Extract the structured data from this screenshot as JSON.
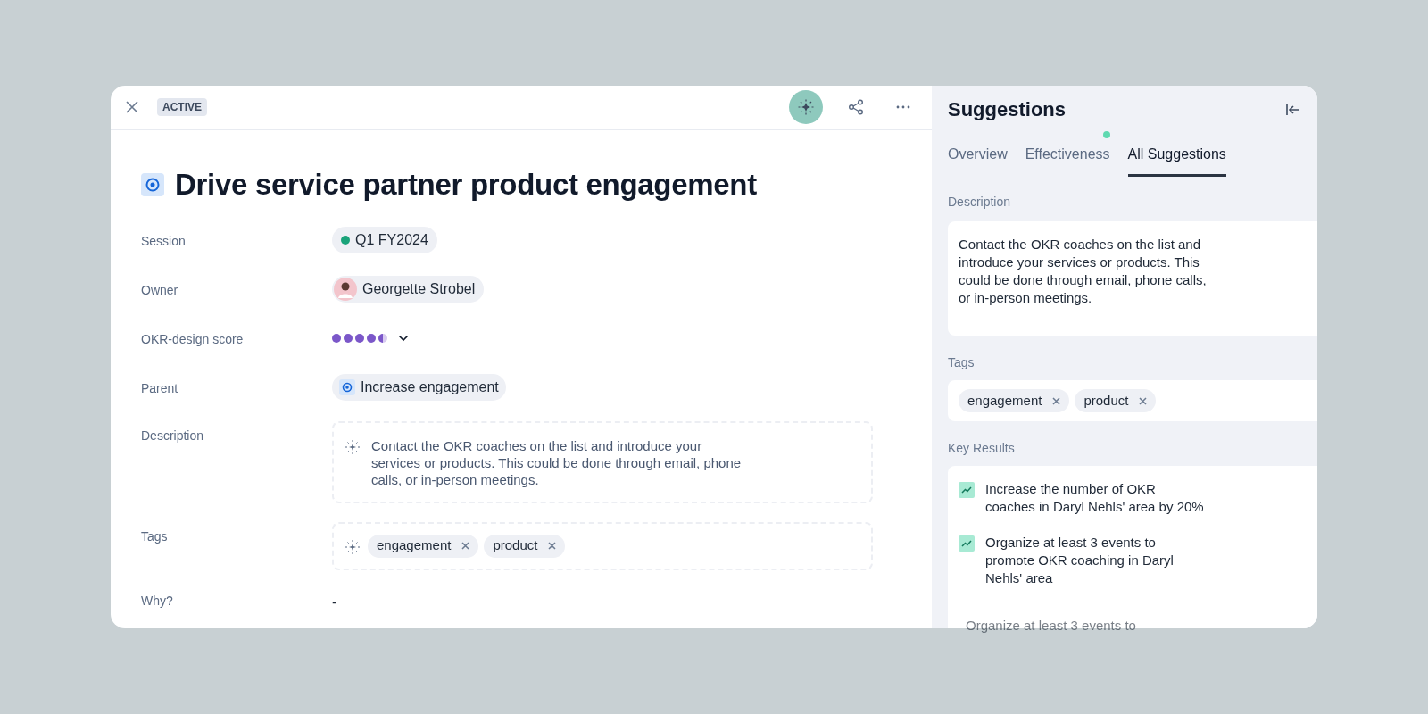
{
  "header": {
    "status_badge": "ACTIVE",
    "ai_button": {
      "selected": true
    }
  },
  "objective": {
    "title": "Drive service partner product engagement",
    "fields": [
      {
        "kind": "session",
        "label": "Session",
        "value": "Q1 FY2024",
        "color": "#1aa37a"
      },
      {
        "kind": "owner",
        "label": "Owner",
        "value": "Georgette Strobel"
      },
      {
        "kind": "score",
        "label": "OKR-design score",
        "stars": 4.5
      },
      {
        "kind": "parent",
        "label": "Parent",
        "value": "Increase engagement"
      },
      {
        "kind": "description",
        "label": "Description",
        "value": "Contact the OKR coaches on the list and introduce your services or products. This could be done through email, phone calls, or in-person meetings."
      },
      {
        "kind": "tags",
        "label": "Tags",
        "tags": [
          "engagement",
          "product"
        ]
      },
      {
        "kind": "text",
        "label": "Why?",
        "value": "-"
      }
    ]
  },
  "suggestions": {
    "title": "Suggestions",
    "tabs": [
      {
        "label": "Overview",
        "selected": false,
        "dot": false
      },
      {
        "label": "Effectiveness",
        "selected": false,
        "dot": true
      },
      {
        "label": "All Suggestions",
        "selected": true,
        "dot": false
      }
    ],
    "description_label": "Description",
    "description": "Contact the OKR coaches on the list and introduce your services or products. This could be done through email, phone calls, or in-person meetings.",
    "tags_label": "Tags",
    "tags": [
      "engagement",
      "product"
    ],
    "key_results_label": "Key Results",
    "key_results": [
      "Increase the number of OKR coaches in Daryl Nehls' area by 20%",
      "Organize at least 3 events to promote OKR coaching in Daryl Nehls' area"
    ],
    "faded_key_result": "Organize at least 3 events to"
  }
}
